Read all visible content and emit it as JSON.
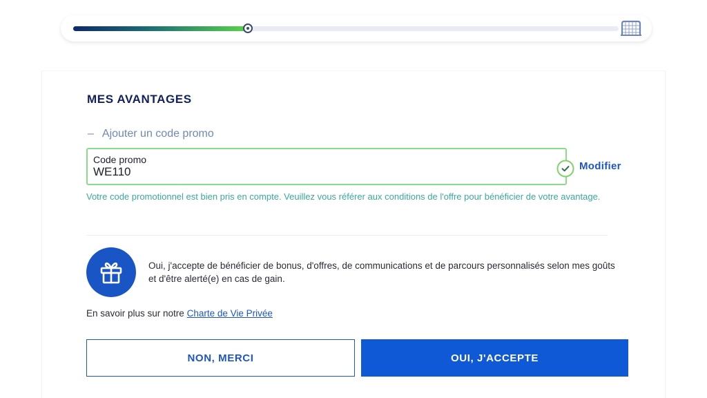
{
  "progress": {
    "value_percent": 32,
    "goal_icon": "goal-net-icon"
  },
  "advantages": {
    "title": "MES AVANTAGES",
    "promo_toggle_symbol": "–",
    "promo_toggle_label": "Ajouter un code promo",
    "promo_field_label": "Code promo",
    "promo_field_value": "WE110",
    "modify_label": "Modifier",
    "success_message": "Votre code promotionnel est bien pris en compte. Veuillez vous référer aux conditions de l'offre pour bénéficier de votre avantage."
  },
  "consent": {
    "icon": "gift-icon",
    "text": "Oui, j'accepte de bénéficier de bonus, d'offres, de communications et de parcours personnalisés selon mes goûts et d'être alerté(e) en cas de gain.",
    "privacy_prefix": "En savoir plus sur notre ",
    "privacy_link": "Charte de Vie Privée"
  },
  "buttons": {
    "decline": "NON, MERCI",
    "accept": "OUI, J'ACCEPTE"
  },
  "colors": {
    "brand_blue": "#0f58d6",
    "title_navy": "#10205e",
    "success_green": "#8bdc8a",
    "success_text": "#3aa8a0"
  }
}
